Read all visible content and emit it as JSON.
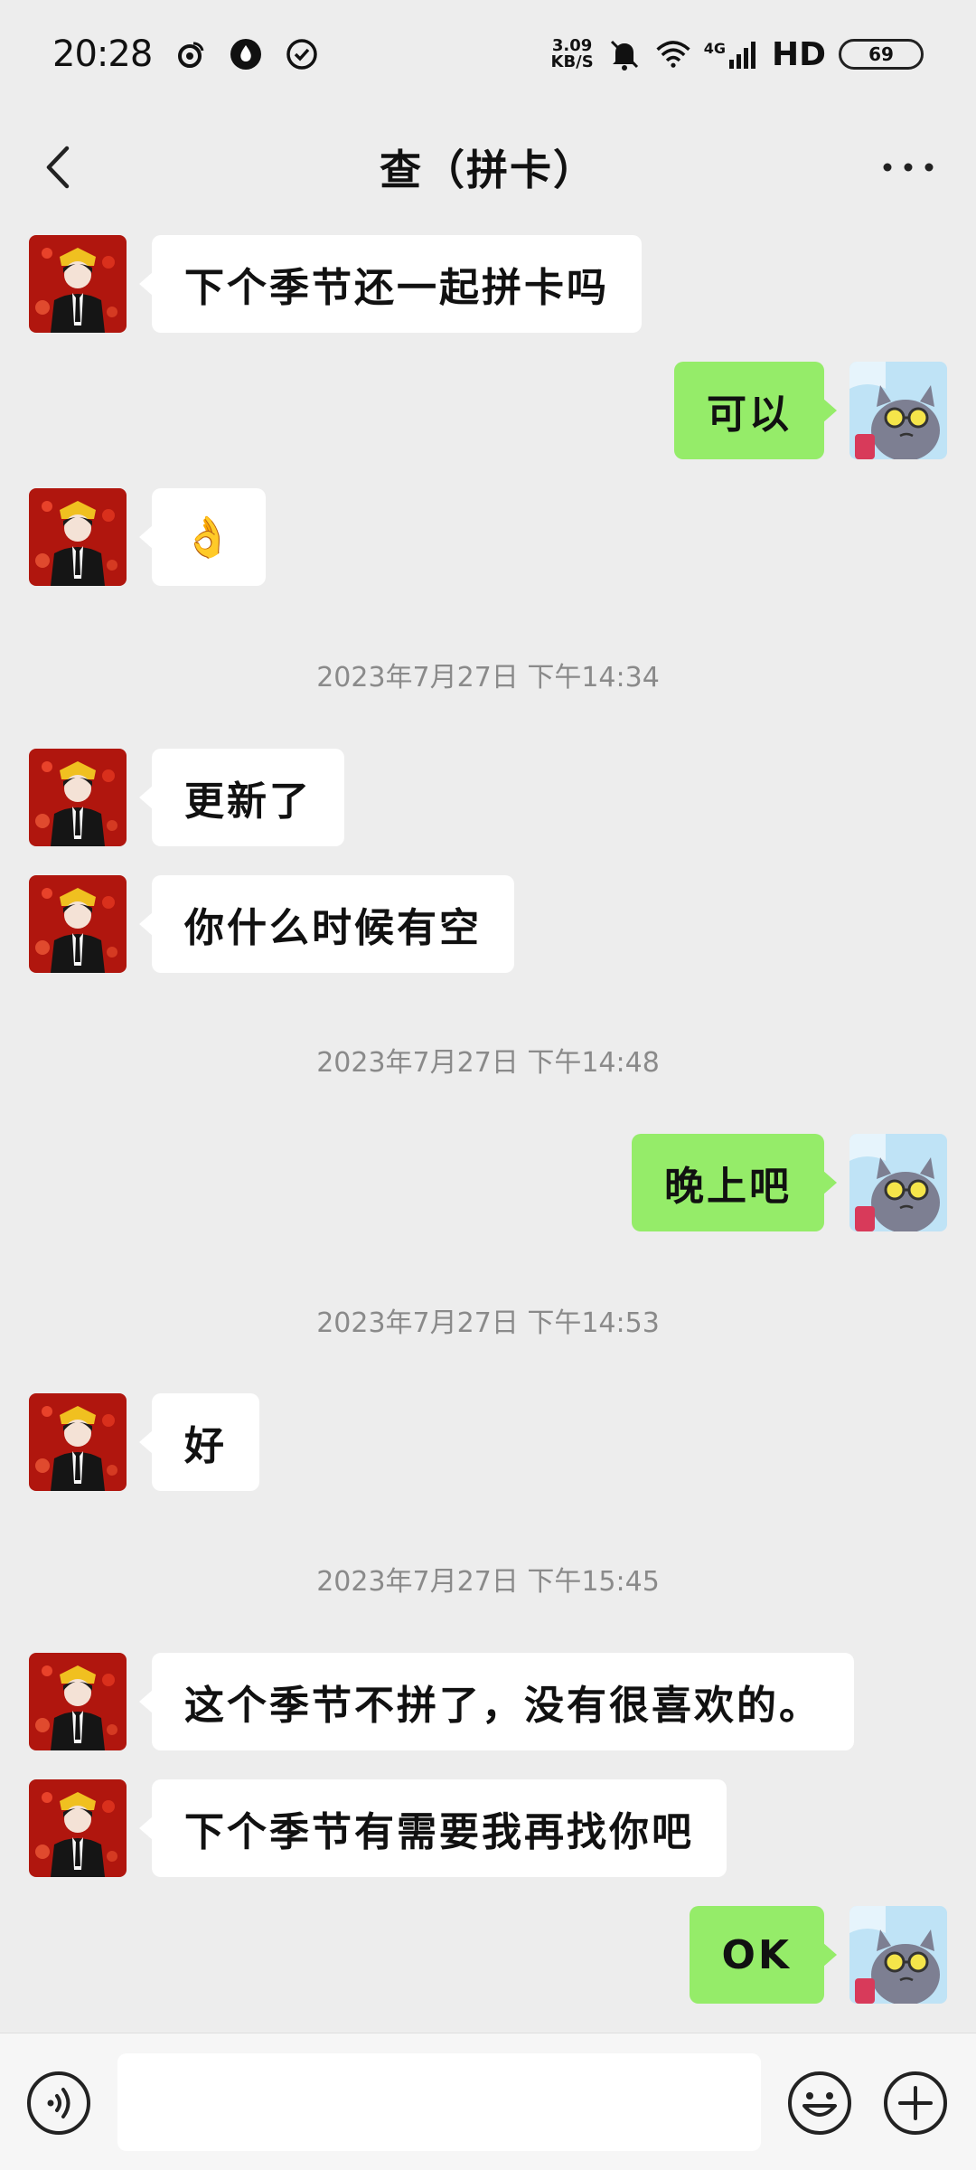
{
  "status_bar": {
    "time": "20:28",
    "net_speed_value": "3.09",
    "net_speed_unit": "KB/S",
    "network": "4G",
    "hd": "HD",
    "battery": "69"
  },
  "nav": {
    "title": "查（拼卡）"
  },
  "messages": [
    {
      "side": "left",
      "text": "下个季节还一起拼卡吗"
    },
    {
      "side": "right",
      "text": "可以"
    },
    {
      "side": "left",
      "text": "👌"
    },
    {
      "timestamp": "2023年7月27日 下午14:34"
    },
    {
      "side": "left",
      "text": "更新了"
    },
    {
      "side": "left",
      "text": "你什么时候有空"
    },
    {
      "timestamp": "2023年7月27日 下午14:48"
    },
    {
      "side": "right",
      "text": "晚上吧"
    },
    {
      "timestamp": "2023年7月27日 下午14:53"
    },
    {
      "side": "left",
      "text": "好"
    },
    {
      "timestamp": "2023年7月27日 下午15:45"
    },
    {
      "side": "left",
      "text": "这个季节不拼了，没有很喜欢的。"
    },
    {
      "side": "left",
      "text": "下个季节有需要我再找你吧"
    },
    {
      "side": "right",
      "text": "OK"
    }
  ],
  "input": {
    "value": ""
  },
  "colors": {
    "background": "#ededed",
    "bubble_sent": "#95ec69",
    "bubble_received": "#ffffff",
    "timestamp": "#8a8a8a"
  }
}
